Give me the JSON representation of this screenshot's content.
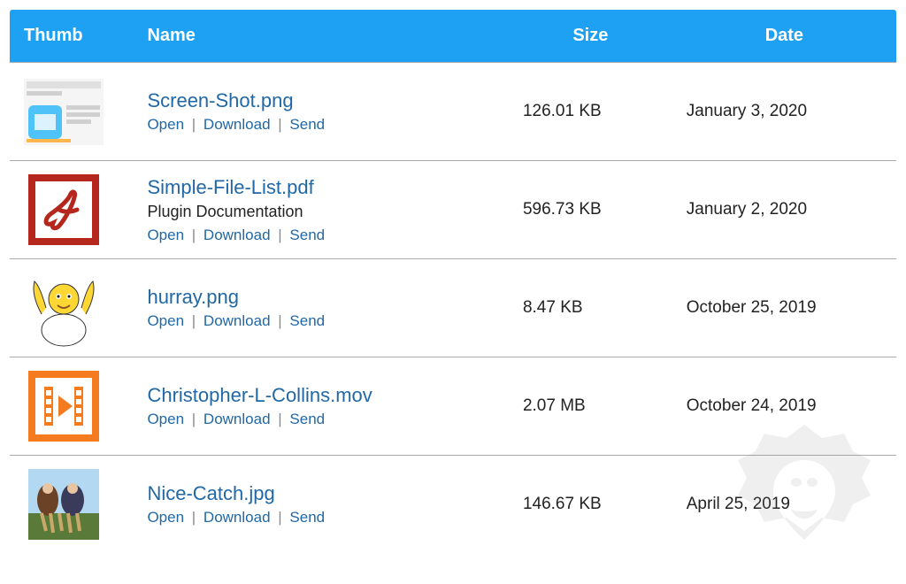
{
  "headers": {
    "thumb": "Thumb",
    "name": "Name",
    "size": "Size",
    "date": "Date"
  },
  "actions": {
    "open": "Open",
    "download": "Download",
    "send": "Send",
    "separator": "|"
  },
  "files": [
    {
      "name": "Screen-Shot.png",
      "description": "",
      "size": "126.01 KB",
      "date": "January 3, 2020",
      "thumb_type": "screenshot"
    },
    {
      "name": "Simple-File-List.pdf",
      "description": "Plugin Documentation",
      "size": "596.73 KB",
      "date": "January 2, 2020",
      "thumb_type": "pdf"
    },
    {
      "name": "hurray.png",
      "description": "",
      "size": "8.47 KB",
      "date": "October 25, 2019",
      "thumb_type": "hurray"
    },
    {
      "name": "Christopher-L-Collins.mov",
      "description": "",
      "size": "2.07 MB",
      "date": "October 24, 2019",
      "thumb_type": "video"
    },
    {
      "name": "Nice-Catch.jpg",
      "description": "",
      "size": "146.67 KB",
      "date": "April 25, 2019",
      "thumb_type": "photo"
    }
  ]
}
